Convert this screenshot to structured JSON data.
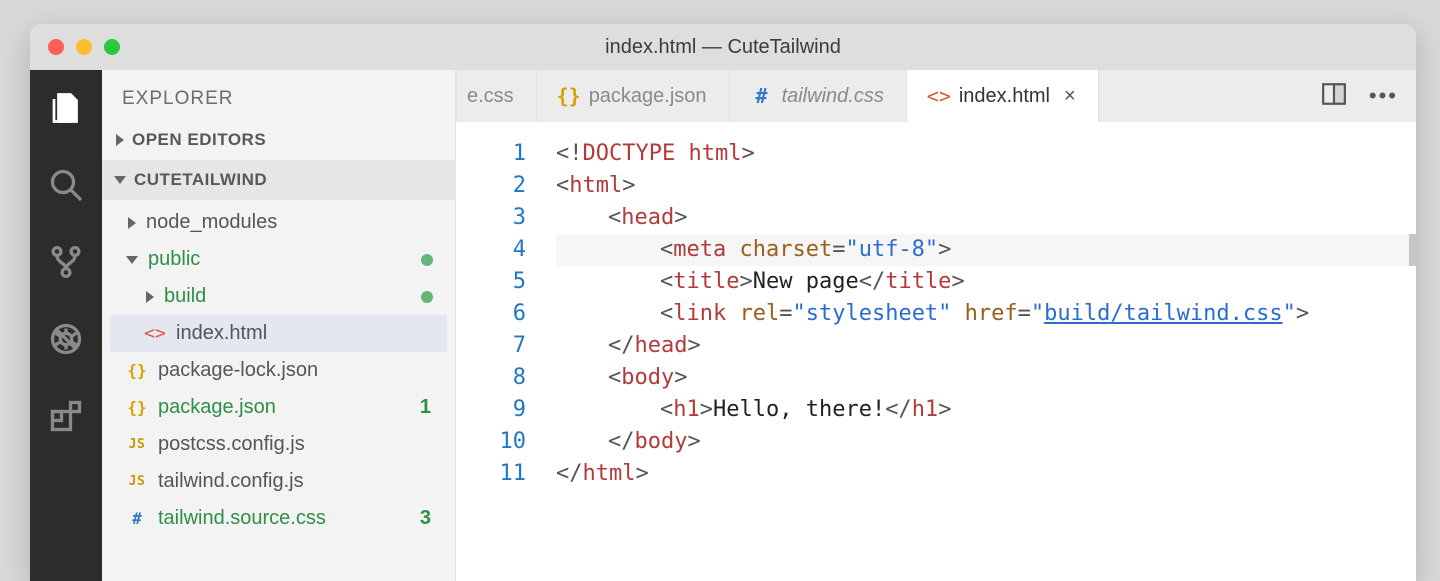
{
  "window": {
    "title": "index.html — CuteTailwind"
  },
  "sidebar": {
    "title": "EXPLORER",
    "open_editors": "OPEN EDITORS",
    "project": "CUTETAILWIND",
    "tree": [
      {
        "label": "node_modules"
      },
      {
        "label": "public"
      },
      {
        "label": "build"
      },
      {
        "label": "index.html"
      },
      {
        "label": "package-lock.json"
      },
      {
        "label": "package.json",
        "badge": "1"
      },
      {
        "label": "postcss.config.js"
      },
      {
        "label": "tailwind.config.js"
      },
      {
        "label": "tailwind.source.css",
        "badge": "3"
      }
    ]
  },
  "editor": {
    "tabs": [
      {
        "label": "e.css"
      },
      {
        "label": "package.json"
      },
      {
        "label": "tailwind.css"
      },
      {
        "label": "index.html"
      }
    ],
    "highlight_line": 4,
    "lines": [
      {
        "n": "1",
        "indent": 0,
        "tokens": [
          {
            "t": "<!",
            "c": "c-punct"
          },
          {
            "t": "DOCTYPE ",
            "c": "c-doctype"
          },
          {
            "t": "html",
            "c": "c-kw"
          },
          {
            "t": ">",
            "c": "c-punct"
          }
        ]
      },
      {
        "n": "2",
        "indent": 0,
        "tokens": [
          {
            "t": "<",
            "c": "c-punct"
          },
          {
            "t": "html",
            "c": "c-tag"
          },
          {
            "t": ">",
            "c": "c-punct"
          }
        ]
      },
      {
        "n": "3",
        "indent": 1,
        "tokens": [
          {
            "t": "<",
            "c": "c-punct"
          },
          {
            "t": "head",
            "c": "c-tag"
          },
          {
            "t": ">",
            "c": "c-punct"
          }
        ]
      },
      {
        "n": "4",
        "indent": 2,
        "tokens": [
          {
            "t": "<",
            "c": "c-punct"
          },
          {
            "t": "meta ",
            "c": "c-tag"
          },
          {
            "t": "charset",
            "c": "c-attr"
          },
          {
            "t": "=",
            "c": "c-punct"
          },
          {
            "t": "\"utf-8\"",
            "c": "c-val"
          },
          {
            "t": ">",
            "c": "c-punct"
          }
        ]
      },
      {
        "n": "5",
        "indent": 2,
        "tokens": [
          {
            "t": "<",
            "c": "c-punct"
          },
          {
            "t": "title",
            "c": "c-tag"
          },
          {
            "t": ">",
            "c": "c-punct"
          },
          {
            "t": "New page",
            "c": "c-text"
          },
          {
            "t": "</",
            "c": "c-punct"
          },
          {
            "t": "title",
            "c": "c-tag"
          },
          {
            "t": ">",
            "c": "c-punct"
          }
        ]
      },
      {
        "n": "6",
        "indent": 2,
        "tokens": [
          {
            "t": "<",
            "c": "c-punct"
          },
          {
            "t": "link ",
            "c": "c-tag"
          },
          {
            "t": "rel",
            "c": "c-attr"
          },
          {
            "t": "=",
            "c": "c-punct"
          },
          {
            "t": "\"stylesheet\" ",
            "c": "c-val"
          },
          {
            "t": "href",
            "c": "c-attr"
          },
          {
            "t": "=",
            "c": "c-punct"
          },
          {
            "t": "\"",
            "c": "c-val"
          },
          {
            "t": "build/tailwind.css",
            "c": "c-link"
          },
          {
            "t": "\"",
            "c": "c-val"
          },
          {
            "t": ">",
            "c": "c-punct"
          }
        ]
      },
      {
        "n": "7",
        "indent": 1,
        "tokens": [
          {
            "t": "</",
            "c": "c-punct"
          },
          {
            "t": "head",
            "c": "c-tag"
          },
          {
            "t": ">",
            "c": "c-punct"
          }
        ]
      },
      {
        "n": "8",
        "indent": 1,
        "tokens": [
          {
            "t": "<",
            "c": "c-punct"
          },
          {
            "t": "body",
            "c": "c-tag"
          },
          {
            "t": ">",
            "c": "c-punct"
          }
        ]
      },
      {
        "n": "9",
        "indent": 2,
        "tokens": [
          {
            "t": "<",
            "c": "c-punct"
          },
          {
            "t": "h1",
            "c": "c-tag"
          },
          {
            "t": ">",
            "c": "c-punct"
          },
          {
            "t": "Hello, there!",
            "c": "c-text"
          },
          {
            "t": "</",
            "c": "c-punct"
          },
          {
            "t": "h1",
            "c": "c-tag"
          },
          {
            "t": ">",
            "c": "c-punct"
          }
        ]
      },
      {
        "n": "10",
        "indent": 1,
        "tokens": [
          {
            "t": "</",
            "c": "c-punct"
          },
          {
            "t": "body",
            "c": "c-tag"
          },
          {
            "t": ">",
            "c": "c-punct"
          }
        ]
      },
      {
        "n": "11",
        "indent": 0,
        "tokens": [
          {
            "t": "</",
            "c": "c-punct"
          },
          {
            "t": "html",
            "c": "c-tag"
          },
          {
            "t": ">",
            "c": "c-punct"
          }
        ]
      }
    ]
  }
}
